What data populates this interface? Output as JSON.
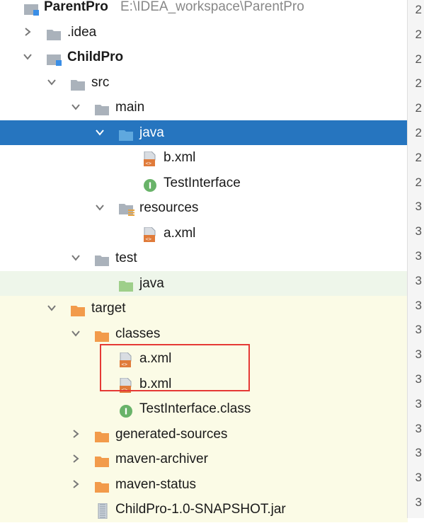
{
  "tree": {
    "root_label": "ParentPro",
    "root_path": "E:\\IDEA_workspace\\ParentPro",
    "idea": ".idea",
    "childpro": "ChildPro",
    "src": "src",
    "main": "main",
    "java_main": "java",
    "b_xml_src": "b.xml",
    "test_interface": "TestInterface",
    "resources": "resources",
    "a_xml_src": "a.xml",
    "test": "test",
    "java_test": "java",
    "target": "target",
    "classes": "classes",
    "a_xml_target": "a.xml",
    "b_xml_target": "b.xml",
    "test_interface_class": "TestInterface.class",
    "generated_sources": "generated-sources",
    "maven_archiver": "maven-archiver",
    "maven_status": "maven-status",
    "jar": "ChildPro-1.0-SNAPSHOT.jar"
  },
  "gutter": [
    "2",
    "2",
    "2",
    "2",
    "2",
    "2",
    "2",
    "2",
    "3",
    "3",
    "3",
    "3",
    "3",
    "3",
    "3",
    "3",
    "3",
    "3",
    "3",
    "3",
    "3"
  ],
  "colors": {
    "selection": "#2675bf",
    "folder": "#aab2bb",
    "source_folder": "#5fa8de",
    "test_folder": "#9ecf8a",
    "excluded_folder": "#f29b4b",
    "interface_icon": "#69b369",
    "highlight_box": "#e53935"
  },
  "icons": {
    "folder": "folder-icon",
    "source-folder": "source-folder-icon",
    "resources-folder": "resources-folder-icon",
    "test-folder": "test-folder-icon",
    "excluded-folder": "excluded-folder-icon",
    "xml-file": "xml-file-icon",
    "interface": "interface-icon",
    "jar": "jar-icon"
  }
}
